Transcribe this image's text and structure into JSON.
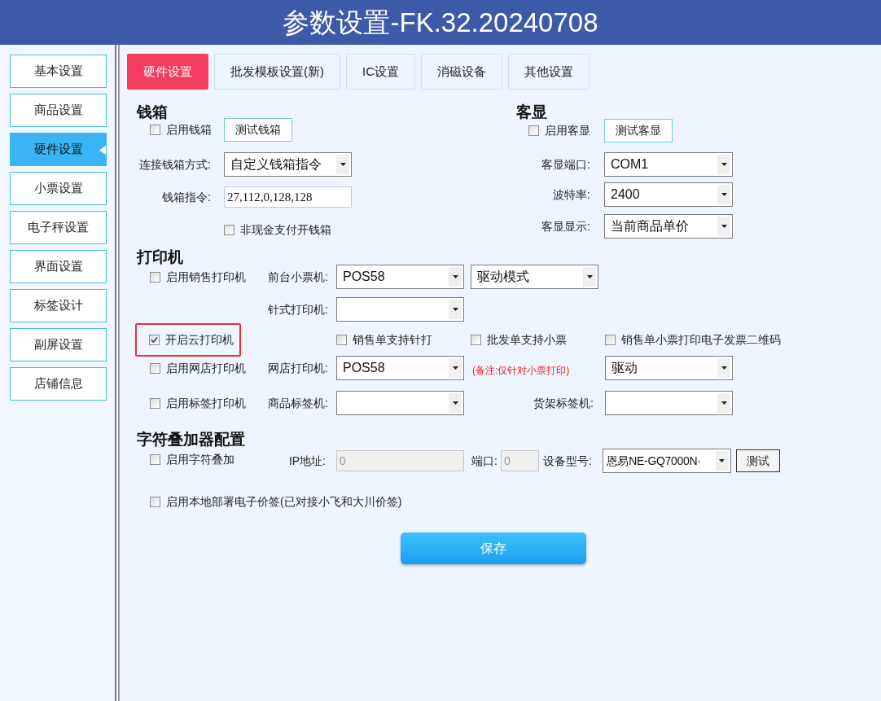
{
  "title": "参数设置-FK.32.20240708",
  "sidebar": {
    "items": [
      {
        "label": "基本设置",
        "selected": false
      },
      {
        "label": "商品设置",
        "selected": false
      },
      {
        "label": "硬件设置",
        "selected": true
      },
      {
        "label": "小票设置",
        "selected": false
      },
      {
        "label": "电子秤设置",
        "selected": false
      },
      {
        "label": "界面设置",
        "selected": false
      },
      {
        "label": "标签设计",
        "selected": false
      },
      {
        "label": "副屏设置",
        "selected": false
      },
      {
        "label": "店铺信息",
        "selected": false
      }
    ]
  },
  "tabs": [
    {
      "label": "硬件设置",
      "selected": true
    },
    {
      "label": "批发模板设置(新)",
      "selected": false
    },
    {
      "label": "IC设置",
      "selected": false
    },
    {
      "label": "消磁设备",
      "selected": false
    },
    {
      "label": "其他设置",
      "selected": false
    }
  ],
  "cash_drawer": {
    "heading": "钱箱",
    "enable": {
      "label": "启用钱箱",
      "checked": false
    },
    "test_button": "测试钱箱",
    "mode": {
      "label": "连接钱箱方式:",
      "value": "自定义钱箱指令"
    },
    "command": {
      "label": "钱箱指令:",
      "value": "27,112,0,128,128"
    },
    "noncash": {
      "label": "非现金支付开钱箱",
      "checked": false
    }
  },
  "customer_display": {
    "heading": "客显",
    "enable": {
      "label": "启用客显",
      "checked": false
    },
    "test_button": "测试客显",
    "port": {
      "label": "客显端口:",
      "value": "COM1"
    },
    "baud": {
      "label": "波特率:",
      "value": "2400"
    },
    "display": {
      "label": "客显显示:",
      "value": "当前商品单价"
    }
  },
  "printer": {
    "heading": "打印机",
    "sales_printer": {
      "label": "启用销售打印机",
      "checked": false
    },
    "front_printer": {
      "label": "前台小票机:",
      "value": "POS58"
    },
    "front_mode": {
      "value": "驱动模式"
    },
    "dot_printer": {
      "label": "针式打印机:"
    },
    "cloud_printer": {
      "label": "开启云打印机",
      "checked": true,
      "highlighted": true
    },
    "options": [
      {
        "label": "销售单支持针打",
        "checked": false
      },
      {
        "label": "批发单支持小票",
        "checked": false
      },
      {
        "label": "销售单小票打印电子发票二维码",
        "checked": false
      }
    ],
    "online_printer": {
      "label": "启用网店打印机",
      "checked": false
    },
    "online_select": {
      "label": "网店打印机:",
      "value": "POS58"
    },
    "note": "(备注:仅针对小票打印)",
    "online_mode": {
      "value": "驱动"
    },
    "label_printer": {
      "label": "启用标签打印机",
      "checked": false
    },
    "goods_label": {
      "label": "商品标签机:"
    },
    "shelf_label": {
      "label": "货架标签机:"
    }
  },
  "overlay": {
    "heading": "字符叠加器配置",
    "enable": {
      "label": "启用字符叠加",
      "checked": false
    },
    "ip": {
      "label": "IP地址:",
      "value": "0",
      "disabled": true
    },
    "port": {
      "label": "端口:",
      "value": "0",
      "disabled": true
    },
    "model": {
      "label": "设备型号:",
      "value": "恩易NE-GQ7000N·"
    },
    "test_button": "测试"
  },
  "esl": {
    "label": "启用本地部署电子价签(已对接小飞和大川价签)",
    "checked": false
  },
  "save_button": "保存"
}
